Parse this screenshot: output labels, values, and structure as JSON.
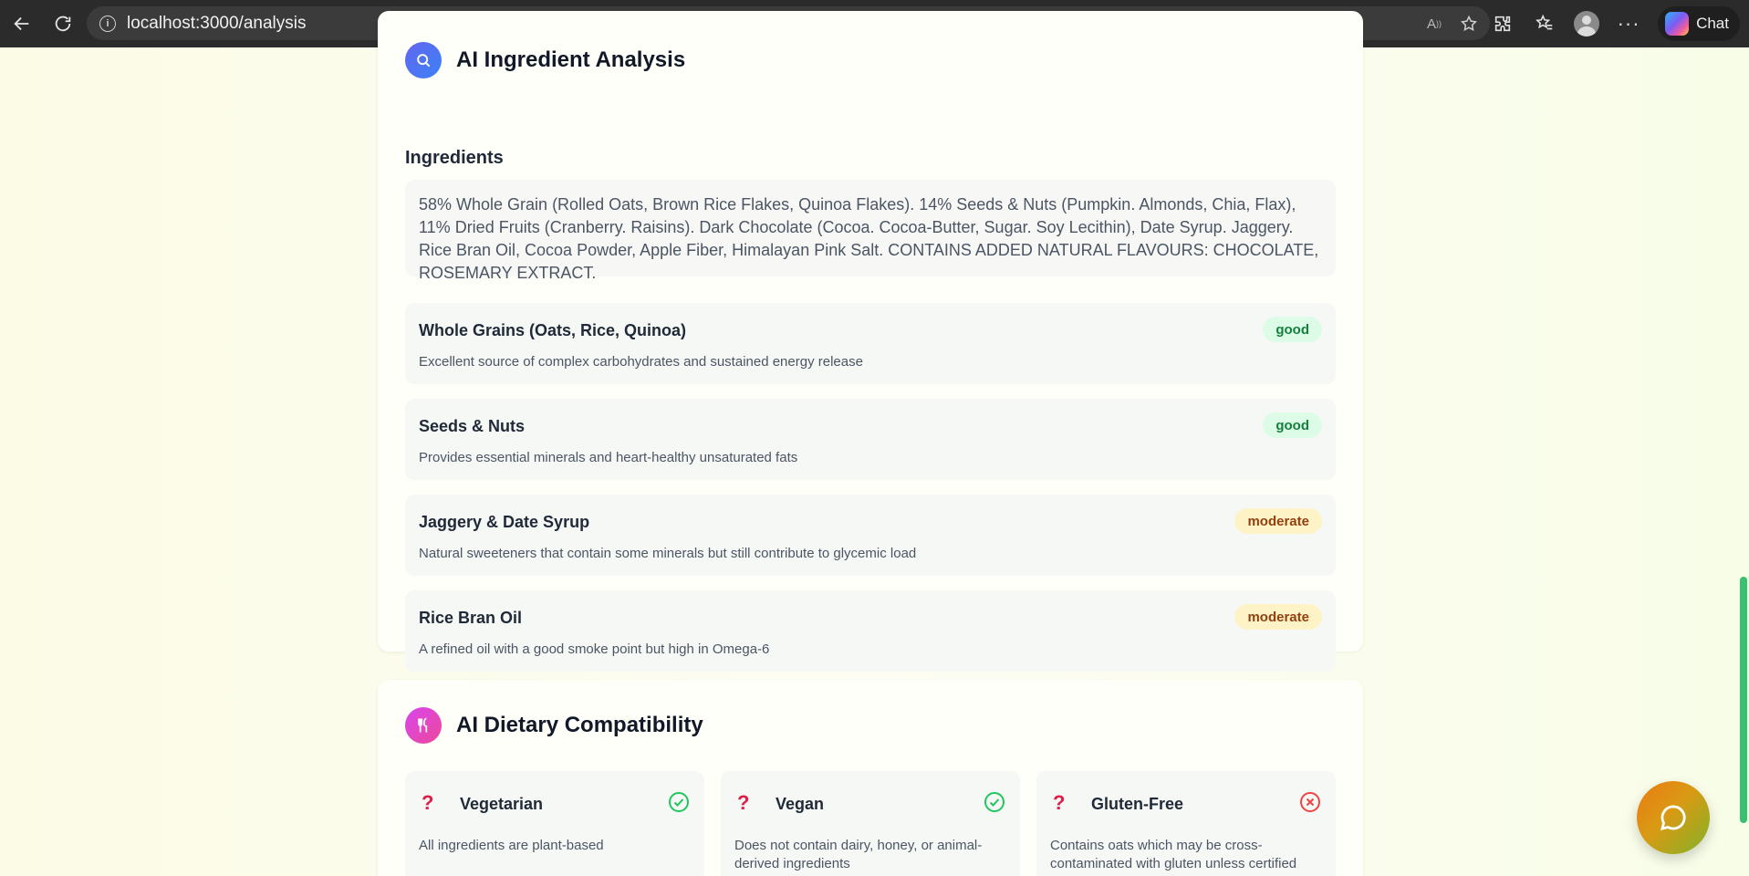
{
  "browser": {
    "url": "localhost:3000/analysis",
    "chat_label": "Chat"
  },
  "ingredient_analysis": {
    "title": "AI Ingredient Analysis",
    "ingredients_label": "Ingredients",
    "ingredients_text": "58% Whole Grain (Rolled Oats, Brown Rice Flakes, Quinoa Flakes). 14% Seeds & Nuts (Pumpkin. Almonds, Chia, Flax), 11% Dried Fruits (Cranberry. Raisins). Dark Chocolate (Cocoa. Cocoa-Butter, Sugar. Soy Lecithin), Date Syrup. Jaggery. Rice Bran Oil, Cocoa Powder, Apple Fiber, Himalayan Pink Salt. CONTAINS ADDED NATURAL FLAVOURS: CHOCOLATE, ROSEMARY EXTRACT.",
    "items": [
      {
        "name": "Whole Grains (Oats, Rice, Quinoa)",
        "rating": "good",
        "desc": "Excellent source of complex carbohydrates and sustained energy release"
      },
      {
        "name": "Seeds & Nuts",
        "rating": "good",
        "desc": "Provides essential minerals and heart-healthy unsaturated fats"
      },
      {
        "name": "Jaggery & Date Syrup",
        "rating": "moderate",
        "desc": "Natural sweeteners that contain some minerals but still contribute to glycemic load"
      },
      {
        "name": "Rice Bran Oil",
        "rating": "moderate",
        "desc": "A refined oil with a good smoke point but high in Omega-6"
      }
    ]
  },
  "dietary": {
    "title": "AI Dietary Compatibility",
    "items": [
      {
        "icon": "?",
        "name": "Vegetarian",
        "compatible": true,
        "desc": "All ingredients are plant-based"
      },
      {
        "icon": "?",
        "name": "Vegan",
        "compatible": true,
        "desc": "Does not contain dairy, honey, or animal-derived ingredients"
      },
      {
        "icon": "?",
        "name": "Gluten-Free",
        "compatible": false,
        "desc": "Contains oats which may be cross-contaminated with gluten unless certified"
      }
    ]
  },
  "colors": {
    "good_bg": "#dcfce7",
    "good_fg": "#15803d",
    "moderate_bg": "#fef3c7",
    "moderate_fg": "#92400e",
    "check": "#22c55e",
    "cross": "#ef4444"
  }
}
